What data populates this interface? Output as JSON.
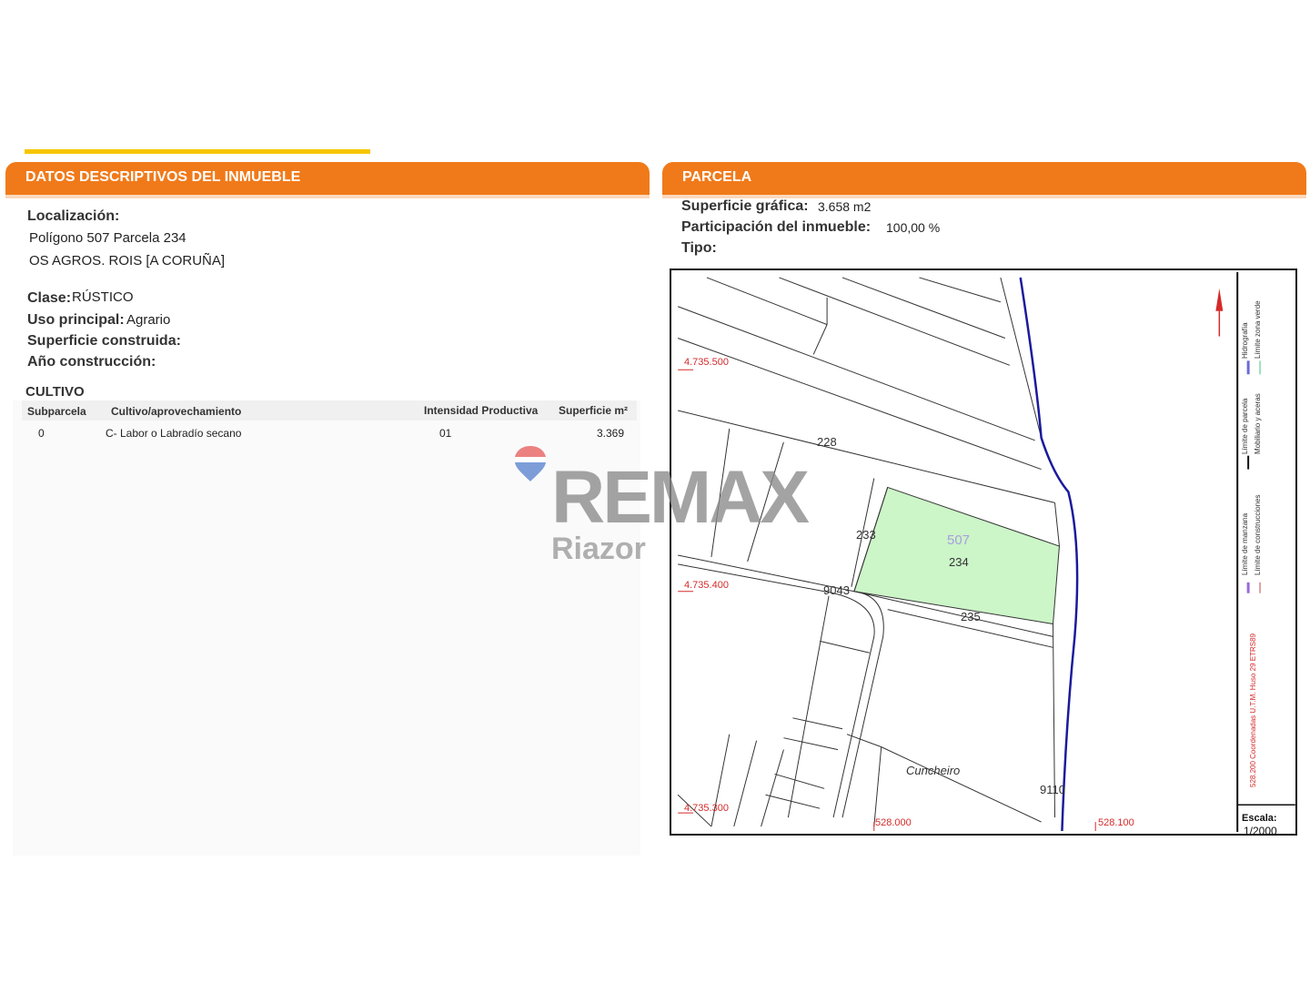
{
  "left": {
    "header": "DATOS DESCRIPTIVOS DEL INMUEBLE",
    "localizacion_label": "Localización:",
    "localizacion_line1": "Polígono 507 Parcela 234",
    "localizacion_line2": "OS AGROS. ROIS [A CORUÑA]",
    "clase_label": "Clase:",
    "clase_value": "RÚSTICO",
    "uso_label": "Uso principal:",
    "uso_value": "Agrario",
    "superficie_construida_label": "Superficie construida:",
    "anio_label": "Año construcción:",
    "cultivo_title": "CULTIVO",
    "table": {
      "headers": [
        "Subparcela",
        "Cultivo/aprovechamiento",
        "Intensidad Productiva",
        "Superficie m²"
      ],
      "rows": [
        [
          "0",
          "C- Labor o Labradío secano",
          "01",
          "3.369"
        ]
      ]
    }
  },
  "right": {
    "header": "PARCELA",
    "superficie_grafica_label": "Superficie gráfica:",
    "superficie_grafica_value": "3.658 m2",
    "participacion_label": "Participación del inmueble:",
    "participacion_value": "100,00 %",
    "tipo_label": "Tipo:"
  },
  "map": {
    "y_labels": [
      "4.735.500",
      "4.735.400",
      "4.735.300"
    ],
    "x_labels": [
      "528.000",
      "528.100"
    ],
    "parcels": [
      "228",
      "233",
      "234",
      "235",
      "9043",
      "9110"
    ],
    "polygon_number": "507",
    "place_name": "Cuncheiro",
    "legend": [
      "Límite de manzana",
      "Límite de construcciones",
      "Límite de parcela",
      "Mobiliario y aceras",
      "Hidrografía",
      "Límite zona verde"
    ],
    "coords_note": "528.200 Coordenadas U.T.M. Huso 29 ETRS89",
    "scale_label": "Escala:",
    "scale_value": "1/2000",
    "colors": {
      "parcel_fill": "#ccf5c8",
      "river": "#1a1a9c",
      "grid_text": "#d42a2a"
    }
  },
  "watermark": {
    "brand": "REMAX",
    "office": "Riazor"
  }
}
